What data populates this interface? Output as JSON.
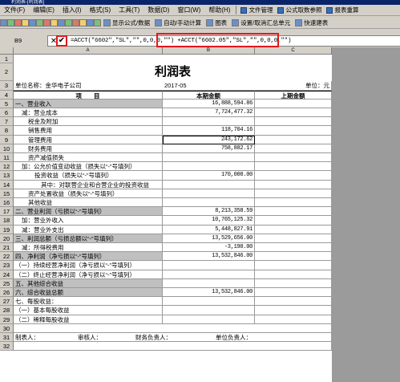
{
  "window": {
    "title": "利润表-[利润表]"
  },
  "menu": {
    "items": [
      "文件(F)",
      "编辑(E)",
      "插入(I)",
      "格式(S)",
      "工具(T)",
      "数据(D)",
      "窗口(W)",
      "帮助(H)"
    ],
    "right": [
      "文件管理",
      "公式取数参照",
      "报表重算"
    ]
  },
  "toolbar": {
    "items": [
      "显示公式/数据",
      "自动/手动计算",
      "图表",
      "设置/取消汇总单元",
      "快速建表"
    ]
  },
  "formula": {
    "cell_ref": "B9",
    "text": "=ACCT(\"6602\",\"SL\",\"\",0,0,0,\"\") +ACCT(\"6602.05\",\"SL\",\"\",0,0,0,\"\")"
  },
  "columns": [
    "A",
    "B",
    "C"
  ],
  "report": {
    "title": "利润表",
    "company": "单位名称：金华电子公司",
    "period": "2017-05",
    "unit": "单位：元",
    "header": [
      "项　　目",
      "本期金额",
      "上期金额"
    ],
    "rows": [
      {
        "label": "一、营业收入",
        "cur": "16,888,594.86",
        "gray": true
      },
      {
        "label": "减：营业成本",
        "cur": "7,724,477.32",
        "indent": 1
      },
      {
        "label": "税金及附加",
        "cur": "",
        "indent": 2
      },
      {
        "label": "销售费用",
        "cur": "118,704.16",
        "indent": 2
      },
      {
        "label": "管理费用",
        "cur": "243,172.62",
        "indent": 2
      },
      {
        "label": "财务费用",
        "cur": "758,882.17",
        "indent": 2
      },
      {
        "label": "资产减值损失",
        "cur": "",
        "indent": 2
      },
      {
        "label": "加：公允价值变动收益（损失以“-”号填列）",
        "cur": "",
        "indent": 1
      },
      {
        "label": "投资收益（损失以“-”号填列）",
        "cur": "170,000.00",
        "indent": 3
      },
      {
        "label": "其中：对联营企业和合营企业的投资收益",
        "cur": "",
        "indent": 4
      },
      {
        "label": "资产处置收益（损失以“-”号填列）",
        "cur": "",
        "indent": 2
      },
      {
        "label": "其他收益",
        "cur": "",
        "indent": 2
      },
      {
        "label": "二、营业利润（亏损以“-”号填列）",
        "cur": "8,213,358.59",
        "gray": true
      },
      {
        "label": "加：营业外收入",
        "cur": "10,765,125.32",
        "indent": 1
      },
      {
        "label": "减：营业外支出",
        "cur": "5,448,827.91",
        "indent": 1
      },
      {
        "label": "三、利润总额（亏损总额以“-”号填列）",
        "cur": "13,529,656.00",
        "gray": true
      },
      {
        "label": "减：所得税费用",
        "cur": "-3,190.00",
        "indent": 1
      },
      {
        "label": "四、净利润（净亏损以“-”号填列）",
        "cur": "13,532,846.00",
        "gray": true
      },
      {
        "label": "（一）持续经营净利润（净亏损以“-”号填列）",
        "cur": ""
      },
      {
        "label": "（二）终止经营净利润（净亏损以“-”号填列）",
        "cur": ""
      },
      {
        "label": "五、其他综合收益",
        "cur": "",
        "gray": true
      },
      {
        "label": "六、综合收益总额",
        "cur": "13,532,846.00",
        "gray": true
      },
      {
        "label": "七、每股收益：",
        "cur": ""
      },
      {
        "label": "（一）基本每股收益",
        "cur": ""
      },
      {
        "label": "（二）稀释每股收益",
        "cur": ""
      }
    ],
    "footer": [
      "制表人：",
      "审核人：",
      "财务负责人：",
      "单位负责人："
    ]
  }
}
